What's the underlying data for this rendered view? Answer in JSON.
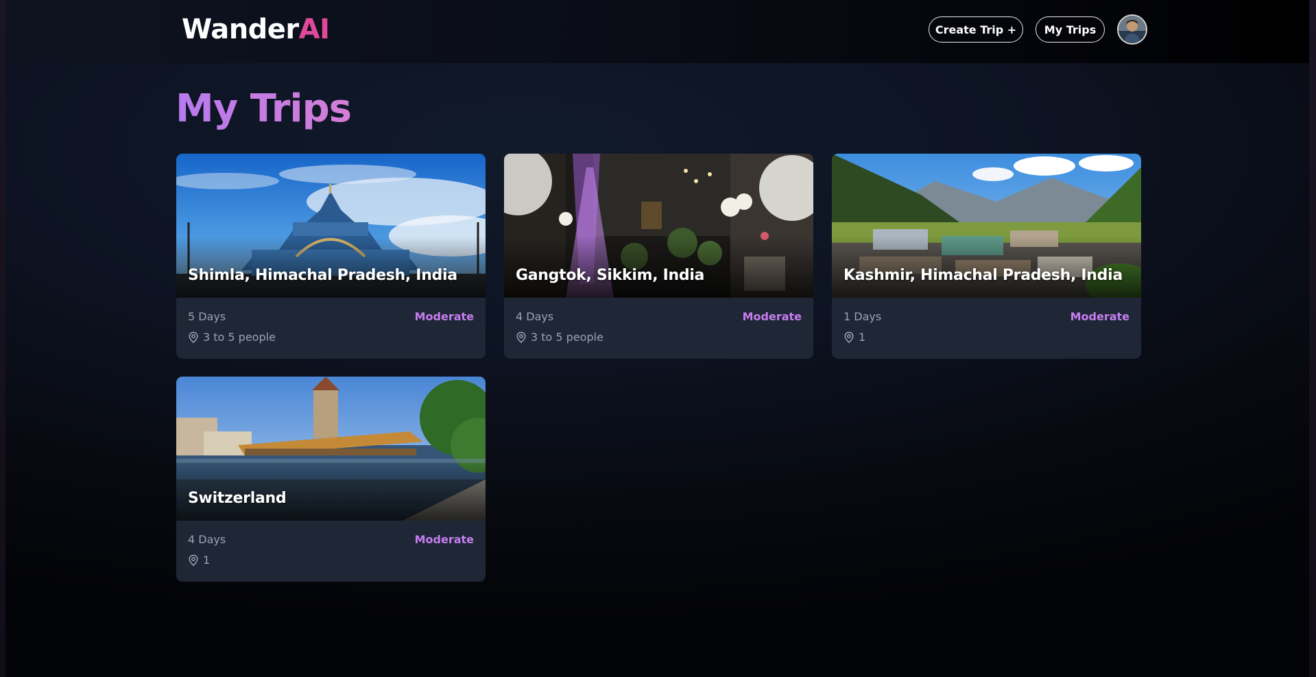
{
  "header": {
    "logo_main": "Wander",
    "logo_accent": "AI",
    "create_trip_label": "Create Trip +",
    "my_trips_label": "My Trips",
    "avatar_icon": "user-avatar"
  },
  "main": {
    "title": "My Trips"
  },
  "trips": [
    {
      "title": "Shimla, Himachal Pradesh, India",
      "days": "5 Days",
      "budget": "Moderate",
      "travelers": "3 to 5 people"
    },
    {
      "title": "Gangtok, Sikkim, India",
      "days": "4 Days",
      "budget": "Moderate",
      "travelers": "3 to 5 people"
    },
    {
      "title": "Kashmir, Himachal Pradesh, India",
      "days": "1 Days",
      "budget": "Moderate",
      "travelers": "1"
    },
    {
      "title": "Switzerland",
      "days": "4 Days",
      "budget": "Moderate",
      "travelers": "1"
    }
  ],
  "colors": {
    "accent": "#c67ef0",
    "logo_accent": "#e0489c",
    "card_bg": "#1f2736",
    "muted_text": "#9ba3b3"
  }
}
